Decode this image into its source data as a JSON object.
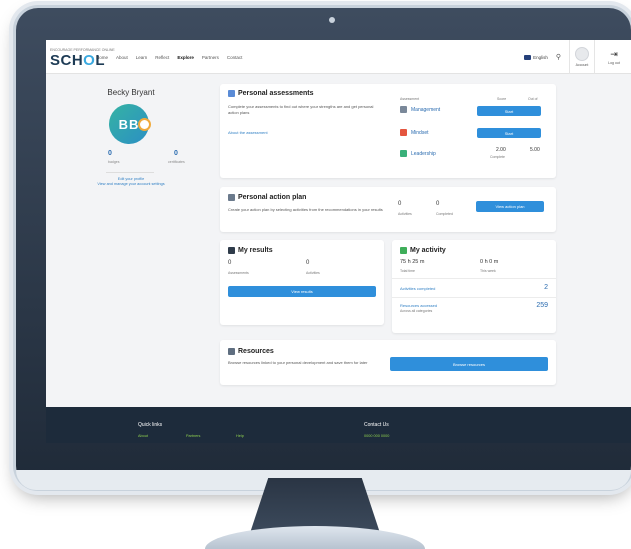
{
  "header": {
    "tagline": "ENCOURAGE PERFORMANCE ONLINE",
    "logo_prefix": "SCH",
    "logo_o": "O",
    "logo_suffix": "L",
    "nav": [
      "Home",
      "About",
      "Learn",
      "Reflect",
      "Explore",
      "Partners",
      "Contact"
    ],
    "nav_active_index": 4,
    "language": "English",
    "account_label": "Account",
    "logout_label": "Log out"
  },
  "profile": {
    "name": "Becky Bryant",
    "initials": "BB",
    "stat1_value": "0",
    "stat1_label": "badges",
    "stat2_value": "0",
    "stat2_label": "certificates",
    "link1": "Edit your profile",
    "link2": "View and manage your account settings"
  },
  "assessments": {
    "title": "Personal assessments",
    "desc": "Complete your assessments to find out where your strengths are and get personal action plans",
    "link": "About the assessment",
    "col_status": "Assessment",
    "col_score": "Score",
    "col_out_of": "Out of",
    "rows": [
      {
        "name": "Management",
        "button": "Start"
      },
      {
        "name": "Mindset",
        "button": "Start"
      },
      {
        "name": "Leadership",
        "score": "2.00",
        "score_sub": "Complete",
        "out_of": "5.00"
      }
    ]
  },
  "action_plan": {
    "title": "Personal action plan",
    "desc": "Create your action plan by selecting activities from the recommendations in your results",
    "stat1_value": "0",
    "stat1_label": "Activities",
    "stat2_value": "0",
    "stat2_label": "Completed",
    "button": "View action plan"
  },
  "my_results": {
    "title": "My results",
    "stat1_value": "0",
    "stat1_label": "Assessments",
    "stat2_value": "0",
    "stat2_label": "Activities",
    "button": "View results"
  },
  "my_activity": {
    "title": "My activity",
    "time1_value": "75 h 25 m",
    "time1_label": "Total time",
    "time2_value": "0 h 0 m",
    "time2_label": "This week",
    "row1_label": "Activities completed",
    "row1_value": "2",
    "row2_label": "Resources accessed",
    "row2_sub": "Across all categories",
    "row2_value": "259"
  },
  "resources": {
    "title": "Resources",
    "desc": "Browse resources linked to your personal development and save them for later",
    "button": "Browse resources"
  },
  "footer": {
    "col1_title": "Quick links",
    "col1_links": [
      "About",
      "Partners",
      "Help"
    ],
    "col2_title": "Contact Us",
    "col2_line": "0000 000 0000"
  },
  "colors": {
    "accent": "#2f8fdb",
    "brand_navy": "#1d3b55",
    "footer_bg": "#1d2b3b",
    "footer_link": "#8fd14f"
  }
}
